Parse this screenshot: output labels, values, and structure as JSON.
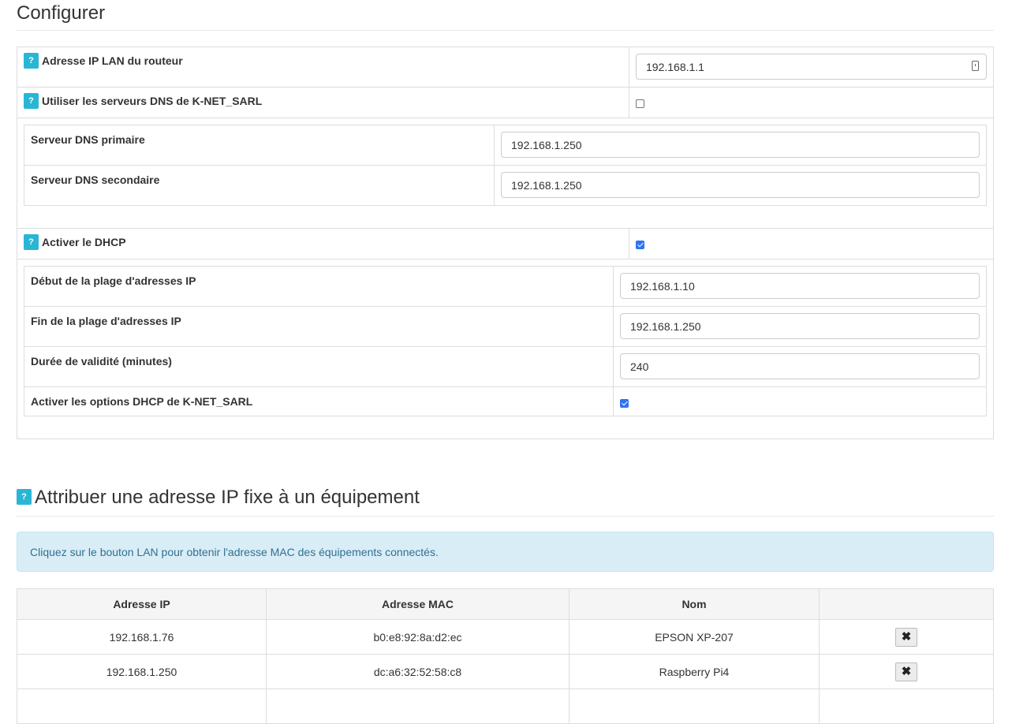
{
  "page": {
    "title": "Configurer"
  },
  "lan": {
    "router_ip_label": "Adresse IP LAN du routeur",
    "router_ip_value": "192.168.1.1",
    "use_dns_label": "Utiliser les serveurs DNS de K-NET_SARL",
    "use_dns_checked": false,
    "dns_primary_label": "Serveur DNS primaire",
    "dns_primary_value": "192.168.1.250",
    "dns_secondary_label": "Serveur DNS secondaire",
    "dns_secondary_value": "192.168.1.250"
  },
  "dhcp": {
    "enable_label": "Activer le DHCP",
    "enable_checked": true,
    "range_start_label": "Début de la plage d'adresses IP",
    "range_start_value": "192.168.1.10",
    "range_end_label": "Fin de la plage d'adresses IP",
    "range_end_value": "192.168.1.250",
    "lease_label": "Durée de validité (minutes)",
    "lease_value": "240",
    "options_label": "Activer les options DHCP de K-NET_SARL",
    "options_checked": true
  },
  "static_ip": {
    "title": "Attribuer une adresse IP fixe à un équipement",
    "info": "Cliquez sur le bouton LAN pour obtenir l'adresse MAC des équipements connectés.",
    "columns": [
      "Adresse IP",
      "Adresse MAC",
      "Nom",
      ""
    ],
    "rows": [
      {
        "ip": "192.168.1.76",
        "mac": "b0:e8:92:8a:d2:ec",
        "name": "EPSON XP-207"
      },
      {
        "ip": "192.168.1.250",
        "mac": "dc:a6:32:52:58:c8",
        "name": "Raspberry Pi4"
      }
    ]
  },
  "icons": {
    "help": "?",
    "delete": "✖"
  },
  "colors": {
    "help_badge": "#29b6d5",
    "checkbox_on": "#2f72f4",
    "alert_bg": "#d9edf7",
    "alert_text": "#31708f"
  }
}
